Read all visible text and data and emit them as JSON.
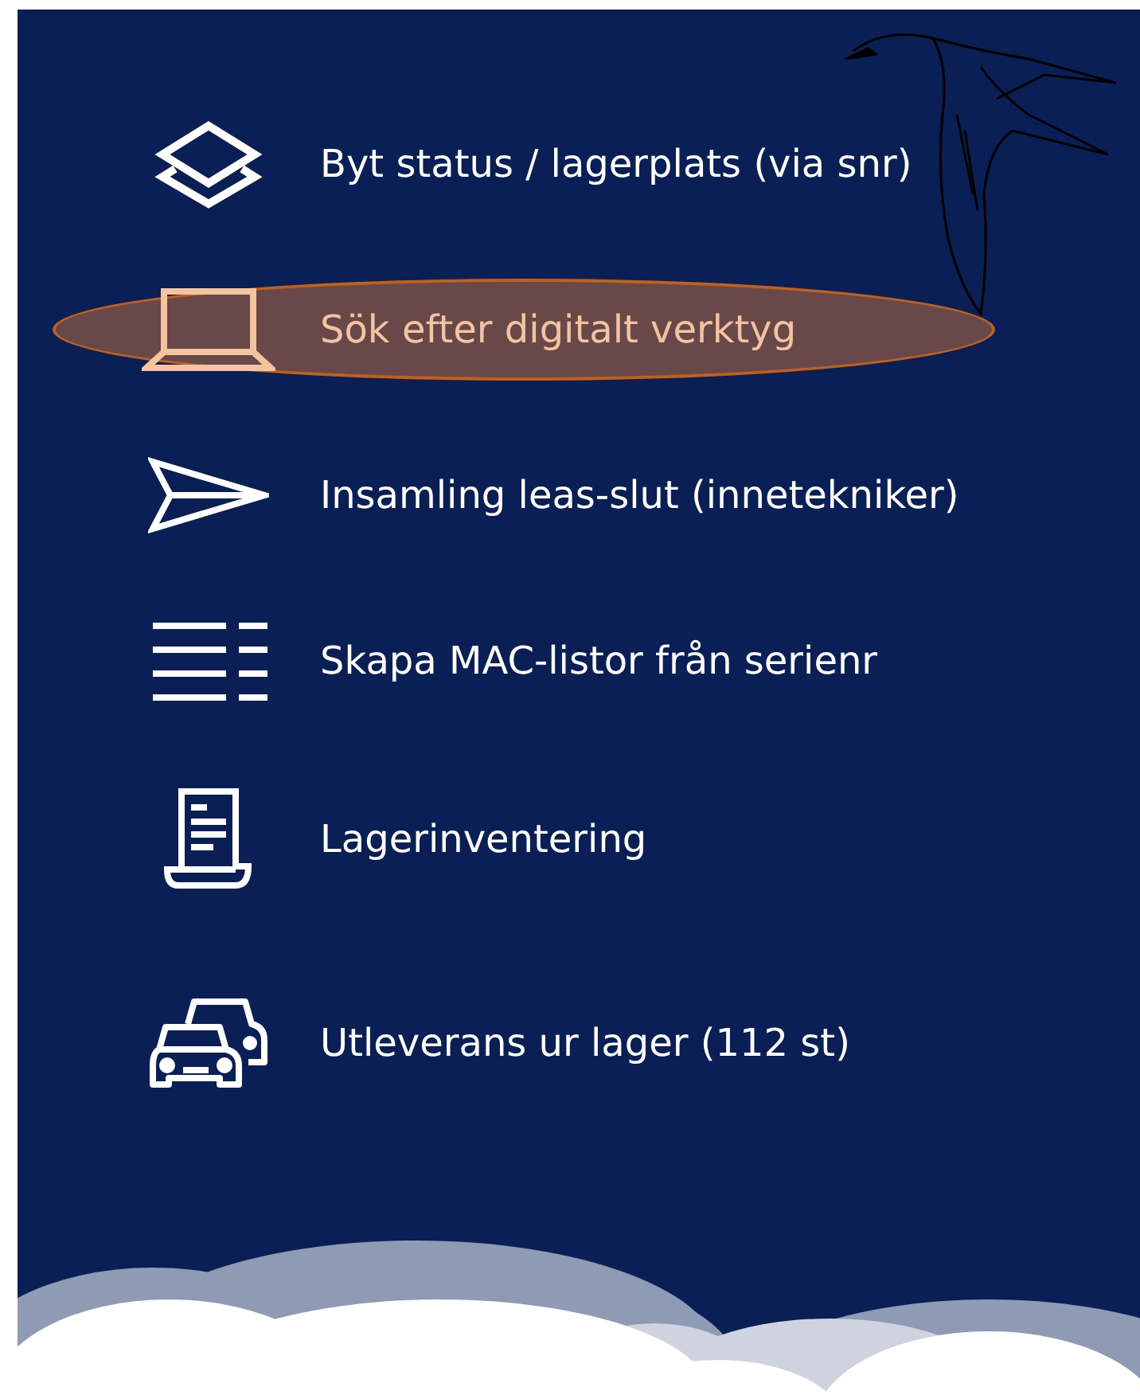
{
  "menu": [
    {
      "kind": "layers",
      "label": "Byt status / lagerplats (via snr)",
      "selected": false
    },
    {
      "kind": "laptop",
      "label": "Sök efter digitalt verktyg",
      "selected": true
    },
    {
      "kind": "send",
      "label": "Insamling leas-slut (innetekniker)",
      "selected": false
    },
    {
      "kind": "list",
      "label": "Skapa MAC-listor från serienr",
      "selected": false
    },
    {
      "kind": "document",
      "label": "Lagerinventering",
      "selected": false
    },
    {
      "kind": "cars",
      "label": "Utleverans ur lager (112 st)",
      "selected": false
    }
  ]
}
